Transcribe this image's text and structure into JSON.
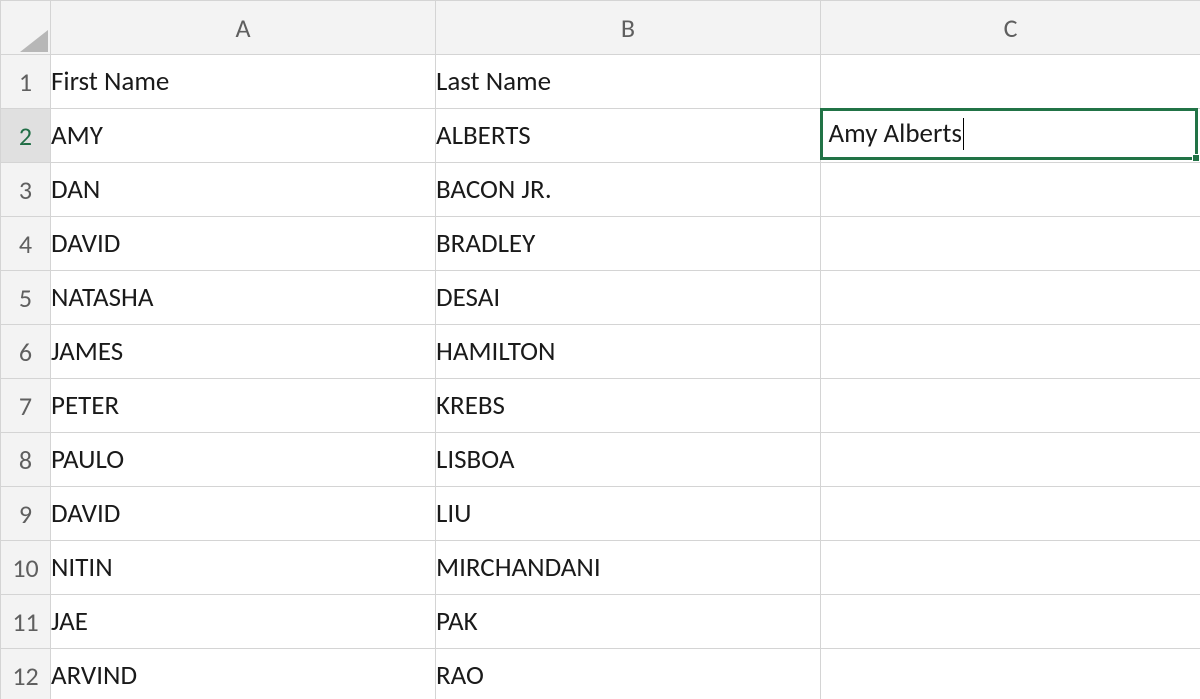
{
  "columns": [
    "A",
    "B",
    "C"
  ],
  "active_row_header": "2",
  "active_cell_value": "Amy Alberts",
  "rows": [
    {
      "num": "1",
      "a": "First Name",
      "b": "Last Name",
      "c": ""
    },
    {
      "num": "2",
      "a": "AMY",
      "b": "ALBERTS",
      "c": ""
    },
    {
      "num": "3",
      "a": "DAN",
      "b": "BACON JR.",
      "c": ""
    },
    {
      "num": "4",
      "a": "DAVID",
      "b": "BRADLEY",
      "c": ""
    },
    {
      "num": "5",
      "a": "NATASHA",
      "b": "DESAI",
      "c": ""
    },
    {
      "num": "6",
      "a": "JAMES",
      "b": "HAMILTON",
      "c": ""
    },
    {
      "num": "7",
      "a": "PETER",
      "b": "KREBS",
      "c": ""
    },
    {
      "num": "8",
      "a": "PAULO",
      "b": "LISBOA",
      "c": ""
    },
    {
      "num": "9",
      "a": "DAVID",
      "b": "LIU",
      "c": ""
    },
    {
      "num": "10",
      "a": "NITIN",
      "b": "MIRCHANDANI",
      "c": ""
    },
    {
      "num": "11",
      "a": "JAE",
      "b": "PAK",
      "c": ""
    },
    {
      "num": "12",
      "a": "ARVIND",
      "b": "RAO",
      "c": ""
    }
  ],
  "colors": {
    "selection_border": "#217346",
    "header_bg": "#f3f3f3",
    "gridline": "#d4d4d4"
  }
}
